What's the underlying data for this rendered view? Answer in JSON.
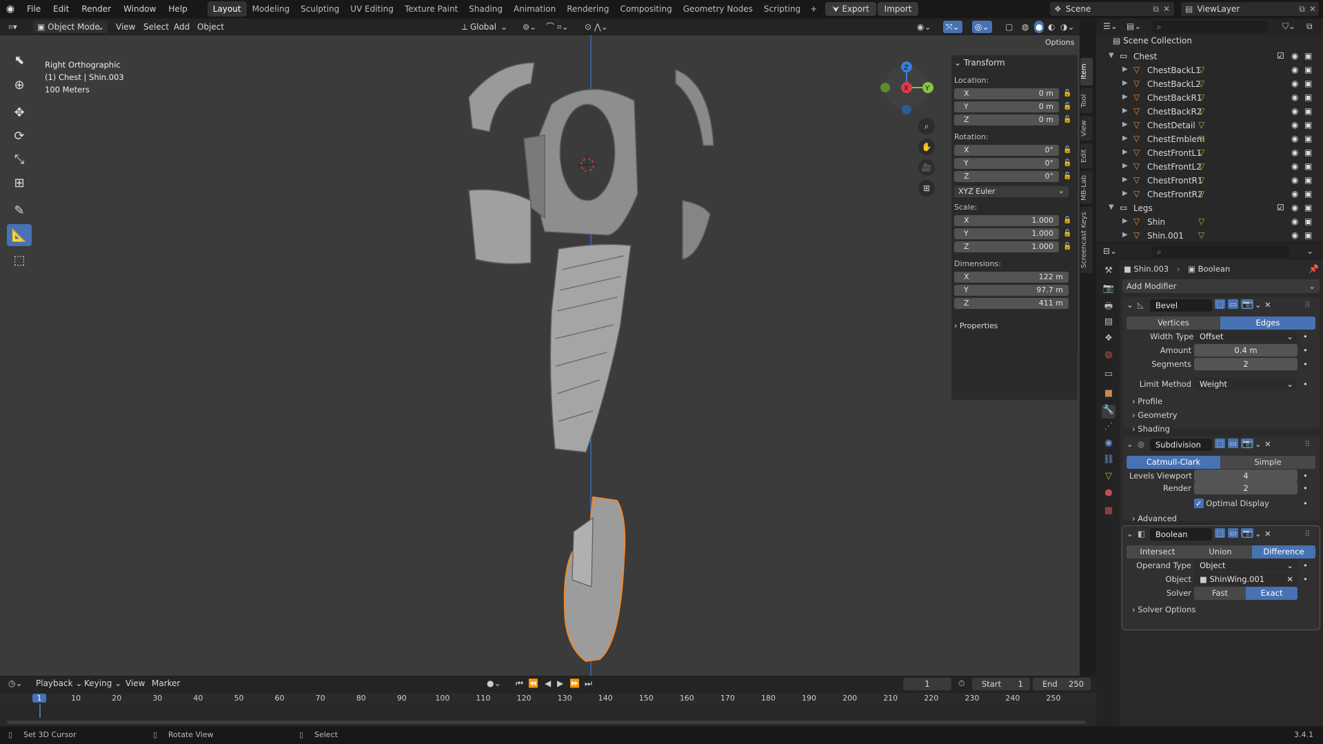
{
  "topbar": {
    "menus": [
      "File",
      "Edit",
      "Render",
      "Window",
      "Help"
    ],
    "workspaces": [
      "Layout",
      "Modeling",
      "Sculpting",
      "UV Editing",
      "Texture Paint",
      "Shading",
      "Animation",
      "Rendering",
      "Compositing",
      "Geometry Nodes",
      "Scripting"
    ],
    "active_workspace": "Layout",
    "export_label": "Export",
    "import_label": "Import",
    "scene": "Scene",
    "view_layer": "ViewLayer"
  },
  "viewport_header": {
    "mode": "Object Mode",
    "menus": [
      "View",
      "Select",
      "Add",
      "Object"
    ],
    "orientation": "Global",
    "options": "Options"
  },
  "overlay": {
    "view_name": "Right Orthographic",
    "object_info": "(1) Chest | Shin.003",
    "scale": "100 Meters"
  },
  "gizmo": {
    "z": "Z",
    "x": "X",
    "y": "Y"
  },
  "npanel": {
    "title": "Transform",
    "location_label": "Location:",
    "location": [
      {
        "axis": "X",
        "value": "0 m"
      },
      {
        "axis": "Y",
        "value": "0 m"
      },
      {
        "axis": "Z",
        "value": "0 m"
      }
    ],
    "rotation_label": "Rotation:",
    "rotation": [
      {
        "axis": "X",
        "value": "0°"
      },
      {
        "axis": "Y",
        "value": "0°"
      },
      {
        "axis": "Z",
        "value": "0°"
      }
    ],
    "rotation_mode": "XYZ Euler",
    "scale_label": "Scale:",
    "scale": [
      {
        "axis": "X",
        "value": "1.000"
      },
      {
        "axis": "Y",
        "value": "1.000"
      },
      {
        "axis": "Z",
        "value": "1.000"
      }
    ],
    "dimensions_label": "Dimensions:",
    "dimensions": [
      {
        "axis": "X",
        "value": "122 m"
      },
      {
        "axis": "Y",
        "value": "97.7 m"
      },
      {
        "axis": "Z",
        "value": "411 m"
      }
    ],
    "properties": "Properties",
    "tabs": [
      "Item",
      "Tool",
      "View",
      "Edit",
      "MB-Lab",
      "Screencast Keys"
    ]
  },
  "outliner": {
    "root": "Scene Collection",
    "items": [
      {
        "label": "Chest",
        "type": "collection",
        "depth": 1
      },
      {
        "label": "ChestBackL1",
        "type": "mesh",
        "depth": 2
      },
      {
        "label": "ChestBackL2",
        "type": "mesh",
        "depth": 2
      },
      {
        "label": "ChestBackR1",
        "type": "mesh",
        "depth": 2
      },
      {
        "label": "ChestBackR2",
        "type": "mesh",
        "depth": 2
      },
      {
        "label": "ChestDetail",
        "type": "mesh",
        "depth": 2
      },
      {
        "label": "ChestEmblem",
        "type": "mesh",
        "depth": 2
      },
      {
        "label": "ChestFrontL1",
        "type": "mesh",
        "depth": 2
      },
      {
        "label": "ChestFrontL2",
        "type": "mesh",
        "depth": 2
      },
      {
        "label": "ChestFrontR1",
        "type": "mesh",
        "depth": 2
      },
      {
        "label": "ChestFrontR2",
        "type": "mesh",
        "depth": 2
      },
      {
        "label": "Legs",
        "type": "collection",
        "depth": 1
      },
      {
        "label": "Shin",
        "type": "mesh",
        "depth": 2
      },
      {
        "label": "Shin.001",
        "type": "mesh",
        "depth": 2
      }
    ]
  },
  "properties": {
    "breadcrumb_object": "Shin.003",
    "breadcrumb_modifier": "Boolean",
    "add_modifier": "Add Modifier",
    "bevel": {
      "name": "Bevel",
      "mode_options": [
        "Vertices",
        "Edges"
      ],
      "mode_active": "Edges",
      "width_type_label": "Width Type",
      "width_type": "Offset",
      "amount_label": "Amount",
      "amount": "0.4 m",
      "segments_label": "Segments",
      "segments": "2",
      "limit_method_label": "Limit Method",
      "limit_method": "Weight",
      "subpanels": [
        "Profile",
        "Geometry",
        "Shading"
      ]
    },
    "subdivision": {
      "name": "Subdivision",
      "mode_options": [
        "Catmull-Clark",
        "Simple"
      ],
      "mode_active": "Catmull-Clark",
      "levels_viewport_label": "Levels Viewport",
      "levels_viewport": "4",
      "render_label": "Render",
      "render": "2",
      "optimal_display": "Optimal Display",
      "advanced": "Advanced"
    },
    "boolean": {
      "name": "Boolean",
      "ops": [
        "Intersect",
        "Union",
        "Difference"
      ],
      "op_active": "Difference",
      "operand_type_label": "Operand Type",
      "operand_type": "Object",
      "object_label": "Object",
      "object": "ShinWing.001",
      "solver_label": "Solver",
      "solvers": [
        "Fast",
        "Exact"
      ],
      "solver_active": "Exact",
      "solver_options": "Solver Options"
    }
  },
  "timeline": {
    "menus": [
      "Playback",
      "Keying",
      "View",
      "Marker"
    ],
    "current_frame": "1",
    "start_label": "Start",
    "start": "1",
    "end_label": "End",
    "end": "250",
    "ticks": [
      "1",
      "10",
      "20",
      "30",
      "40",
      "50",
      "60",
      "70",
      "80",
      "90",
      "100",
      "110",
      "120",
      "130",
      "140",
      "150",
      "160",
      "170",
      "180",
      "190",
      "200",
      "210",
      "220",
      "230",
      "240",
      "250"
    ]
  },
  "statusbar": {
    "hint1": "Set 3D Cursor",
    "hint2": "Rotate View",
    "hint3": "Select",
    "version": "3.4.1"
  },
  "colors": {
    "accent": "#4772b3",
    "selection": "#f0892d",
    "x_axis": "#e03a4a",
    "y_axis": "#8bc440",
    "z_axis": "#3c7dd8"
  }
}
